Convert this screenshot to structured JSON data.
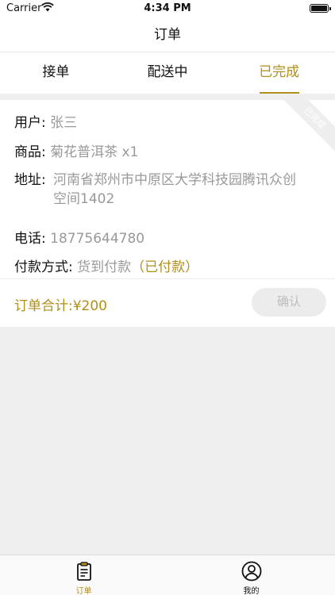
{
  "status_bar": {
    "carrier": "Carrier",
    "time": "4:34 PM"
  },
  "nav": {
    "title": "订单"
  },
  "tabs": [
    {
      "label": "接单"
    },
    {
      "label": "配送中"
    },
    {
      "label": "已完成",
      "active": true
    }
  ],
  "order": {
    "ribbon": "已完成",
    "user_label": "用户:",
    "user_value": "张三",
    "product_label": "商品:",
    "product_value": "菊花普洱茶 x1",
    "address_label": "地址:",
    "address_value": "河南省郑州市中原区大学科技园腾讯众创空间1402",
    "phone_label": "电话:",
    "phone_value": "18775644780",
    "payment_label": "付款方式:",
    "payment_value": "货到付款",
    "payment_status": "（已付款）",
    "total": "订单合计:¥200",
    "confirm_button": "确认"
  },
  "tab_bar": [
    {
      "label": "订单",
      "icon": "order-icon",
      "active": true
    },
    {
      "label": "我的",
      "icon": "user-icon"
    }
  ],
  "colors": {
    "accent": "#b08f1a",
    "muted": "#999999"
  }
}
